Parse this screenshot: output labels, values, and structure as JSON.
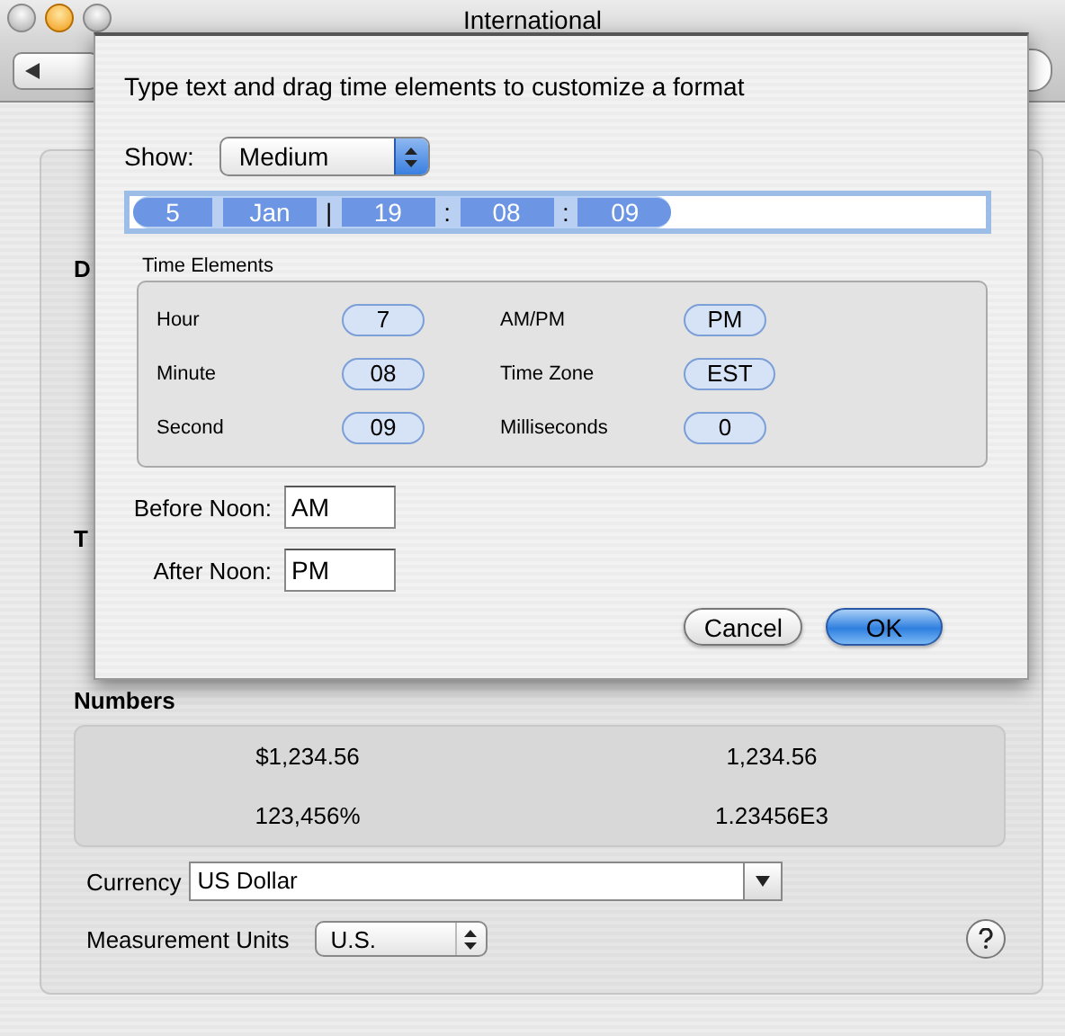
{
  "window": {
    "title": "International"
  },
  "background": {
    "dates_heading": "D",
    "times_heading": "T",
    "numbers_heading": "Numbers",
    "numbers": [
      "$1,234.56",
      "1,234.56",
      "123,456%",
      "1.23456E3"
    ],
    "currency": {
      "label": "Currency",
      "value": "US Dollar"
    },
    "measurement": {
      "label": "Measurement Units",
      "value": "U.S."
    }
  },
  "sheet": {
    "instruction": "Type text and drag time elements to customize a format",
    "show": {
      "label": "Show:",
      "value": "Medium"
    },
    "format_tokens": [
      {
        "kind": "token",
        "text": "5"
      },
      {
        "kind": "token",
        "text": "Jan"
      },
      {
        "kind": "separator",
        "text": "|"
      },
      {
        "kind": "token",
        "text": "19"
      },
      {
        "kind": "separator",
        "text": ":"
      },
      {
        "kind": "token",
        "text": "08"
      },
      {
        "kind": "separator",
        "text": ":"
      },
      {
        "kind": "token",
        "text": "09"
      }
    ],
    "time_elements": {
      "title": "Time Elements",
      "items": [
        {
          "label": "Hour",
          "value": "7"
        },
        {
          "label": "AM/PM",
          "value": "PM"
        },
        {
          "label": "Minute",
          "value": "08"
        },
        {
          "label": "Time Zone",
          "value": "EST"
        },
        {
          "label": "Second",
          "value": "09"
        },
        {
          "label": "Milliseconds",
          "value": "0"
        }
      ]
    },
    "before_noon": {
      "label": "Before Noon:",
      "value": "AM"
    },
    "after_noon": {
      "label": "After Noon:",
      "value": "PM"
    },
    "buttons": [
      {
        "label": "Cancel",
        "kind": "normal"
      },
      {
        "label": "OK",
        "kind": "default"
      }
    ]
  }
}
